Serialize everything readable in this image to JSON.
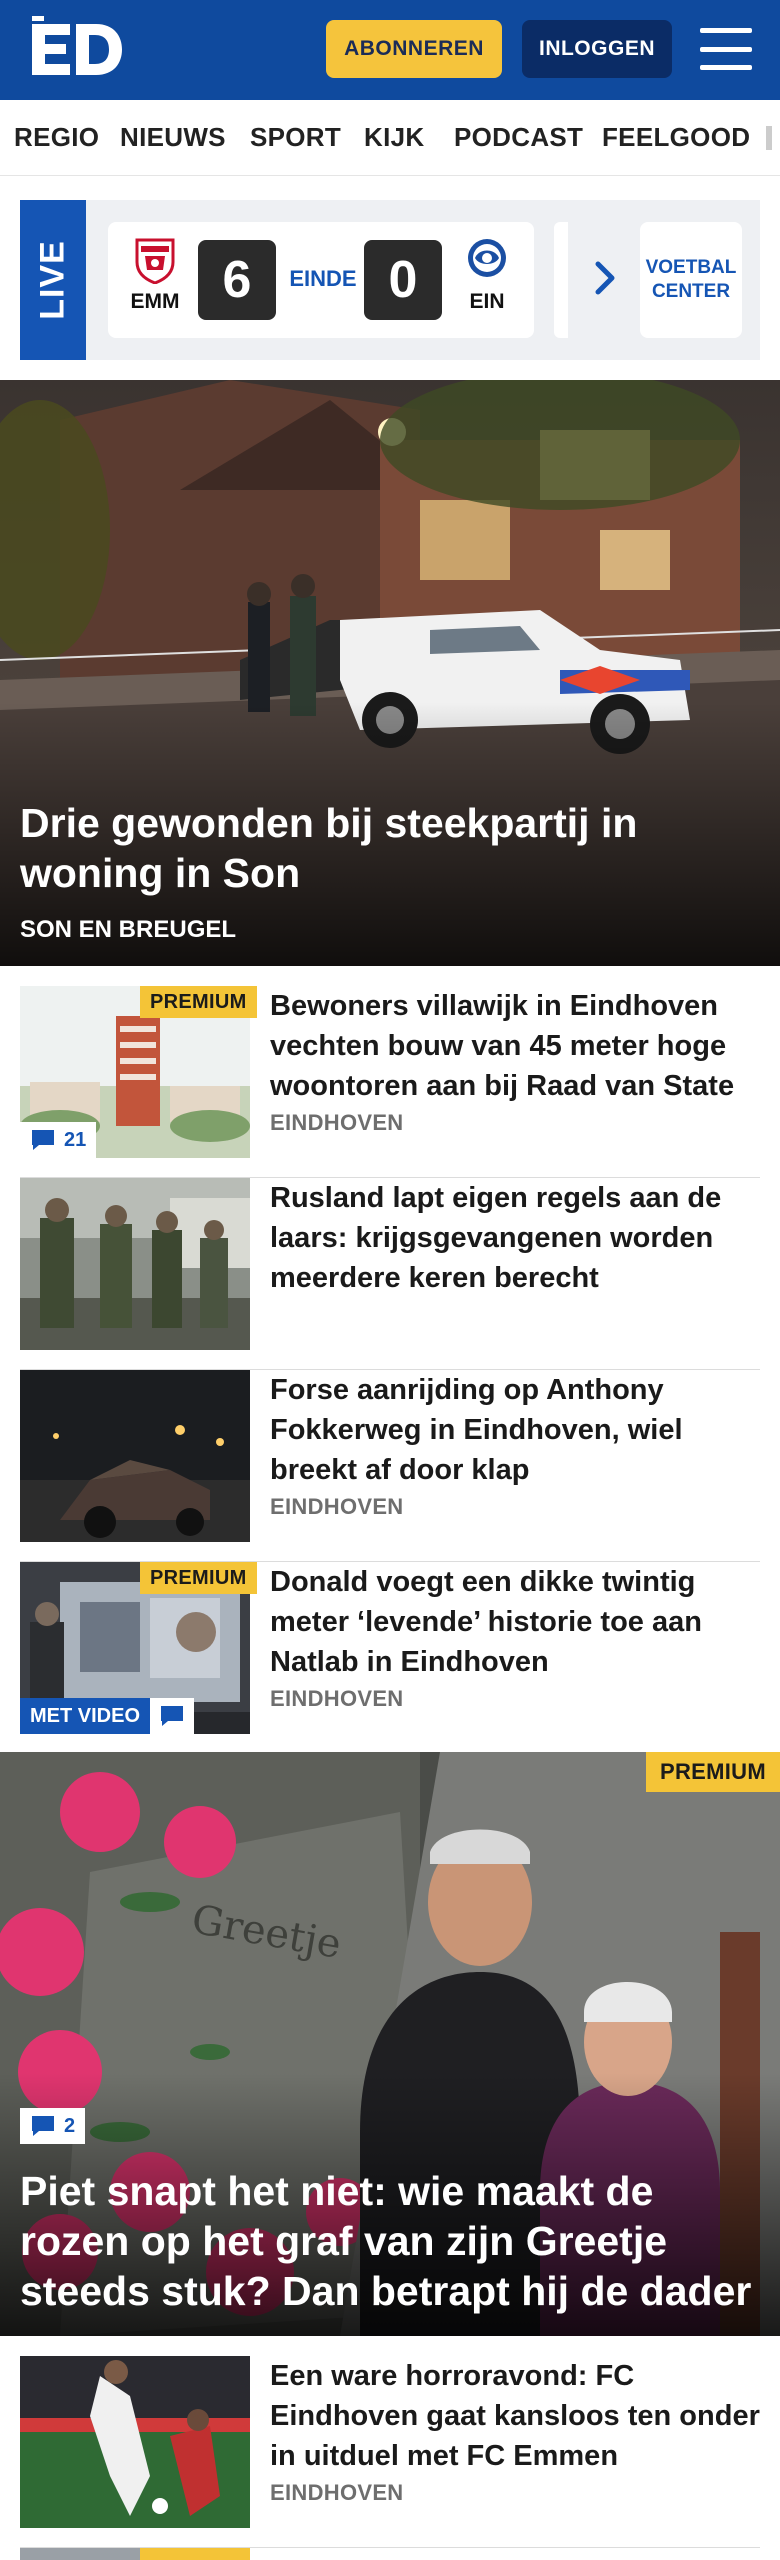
{
  "header": {
    "logo_text": "ED",
    "subscribe_label": "ABONNEREN",
    "login_label": "INLOGGEN",
    "colors": {
      "brand": "#0f4a9e",
      "accent": "#f5c43c",
      "login_bg": "#0b2c66"
    }
  },
  "nav": {
    "items": [
      "REGIO",
      "NIEUWS",
      "SPORT",
      "KIJK",
      "PODCAST",
      "FEELGOOD"
    ]
  },
  "live": {
    "label": "LIVE",
    "match": {
      "home": "EMM",
      "away": "EIN",
      "home_score": "6",
      "away_score": "0",
      "status": "EINDE"
    },
    "voetbal_center_label": "VOETBAL CENTER"
  },
  "hero": {
    "title": "Drie gewonden bij steekpartij in woning in Son",
    "kicker": "SON EN BREUGEL"
  },
  "articles": [
    {
      "title": "Bewoners villawijk in Eindhoven vechten bouw van 45 meter hoge woontoren aan bij Raad van State",
      "kicker": "EINDHOVEN",
      "premium": "PREMIUM",
      "comments": "21"
    },
    {
      "title": "Rusland lapt eigen regels aan de laars: krijgsgevangenen worden meerdere keren berecht",
      "kicker": ""
    },
    {
      "title": "Forse aanrijding op Anthony Fokkerweg in Eindhoven, wiel breekt af door klap",
      "kicker": "EINDHOVEN"
    },
    {
      "title": "Donald voegt een dikke twintig meter ‘levende’ historie toe aan Natlab in Eindhoven",
      "kicker": "EINDHOVEN",
      "premium": "PREMIUM",
      "video": "MET VIDEO"
    }
  ],
  "big_story": {
    "title": "Piet snapt het niet: wie maakt de rozen op het graf van zijn Greetje steeds stuk? Dan betrapt hij de dader",
    "premium": "PREMIUM",
    "comments": "2"
  },
  "article_last": {
    "title": "Een ware horroravond: FC Eindhoven gaat kansloos ten onder in uitduel met FC Emmen",
    "kicker": "EINDHOVEN"
  }
}
